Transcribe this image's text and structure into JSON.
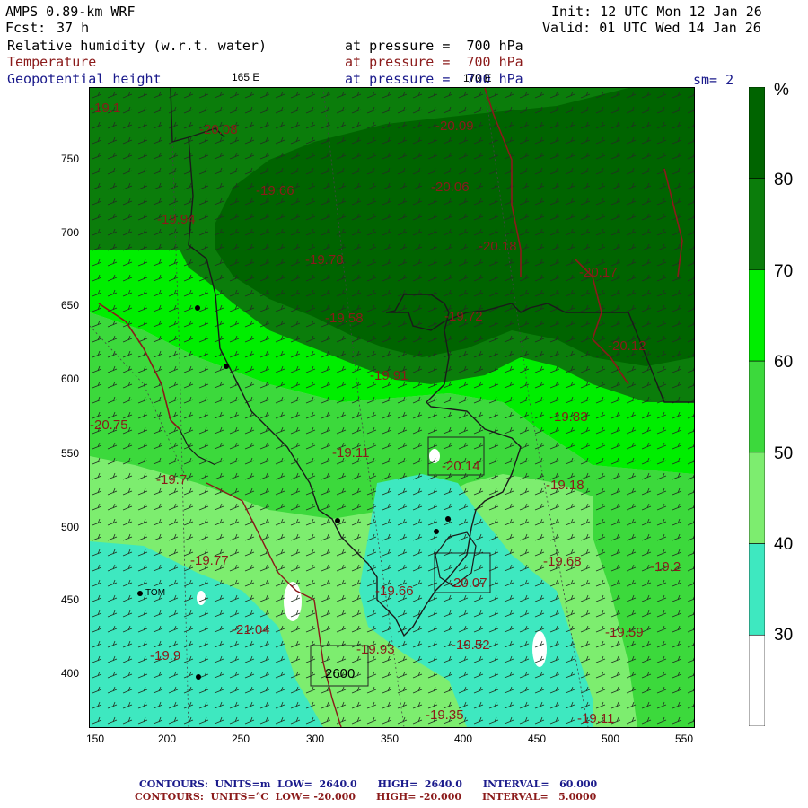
{
  "header": {
    "model": "AMPS 0.89-km WRF",
    "fcst_label": "Fcst:",
    "fcst_value": "37 h",
    "init": "Init: 12 UTC Mon 12 Jan 26",
    "valid": "Valid: 01 UTC Wed 14 Jan 26",
    "fields": [
      {
        "name": "Relative humidity (w.r.t. water)",
        "level": "at pressure =  700 hPa"
      },
      {
        "name": "Temperature",
        "level": "at pressure =  700 hPa"
      },
      {
        "name": "Geopotential height",
        "level": "at pressure =  700 hPa"
      }
    ],
    "lon_label_1": "165 E",
    "lon_label_2": "170 E",
    "smoothing": "sm= 2"
  },
  "axes": {
    "x_ticks": [
      "150",
      "200",
      "250",
      "300",
      "350",
      "400",
      "450",
      "500",
      "550"
    ],
    "y_ticks": [
      "750",
      "700",
      "650",
      "600",
      "550",
      "500",
      "450",
      "400"
    ]
  },
  "colorbar": {
    "unit": "%",
    "labels": [
      "80",
      "70",
      "60",
      "50",
      "40",
      "30"
    ],
    "bands": [
      {
        "from": 80,
        "to": 100,
        "color": "#006400"
      },
      {
        "from": 70,
        "to": 80,
        "color": "#0b7d0b"
      },
      {
        "from": 60,
        "to": 70,
        "color": "#00ee00"
      },
      {
        "from": 50,
        "to": 60,
        "color": "#3cd93c"
      },
      {
        "from": 40,
        "to": 50,
        "color": "#7ded6f"
      },
      {
        "from": 30,
        "to": 40,
        "color": "#3ee8c0"
      },
      {
        "from": 20,
        "to": 30,
        "color": "#ffffff"
      }
    ]
  },
  "map_labels": {
    "temperature": [
      "-19.1",
      "-20.08",
      "-20.09",
      "-19.66",
      "-20.06",
      "-19.94",
      "-19.78",
      "-20.18",
      "-20.17",
      "-19.58",
      "-19.72",
      "-20.12",
      "-19.91",
      "-20.75",
      "-19.83",
      "-19.11",
      "-20.14",
      "-19.7",
      "-19.18",
      "-19.77",
      "-19.68",
      "-19.66",
      "-20.07",
      "-19.2",
      "-21.04",
      "-19.59",
      "-19.9",
      "-19.93",
      "-19.52",
      "-19.35",
      "-19.11"
    ],
    "height": [
      "2600"
    ],
    "station": "TOM"
  },
  "footer": {
    "line1": "CONTOURS:  UNITS=m  LOW=  2640.0      HIGH=  2640.0      INTERVAL=   60.000",
    "line2": "CONTOURS:  UNITS=°C  LOW= -20.000      HIGH= -20.000      INTERVAL=   5.0000"
  }
}
